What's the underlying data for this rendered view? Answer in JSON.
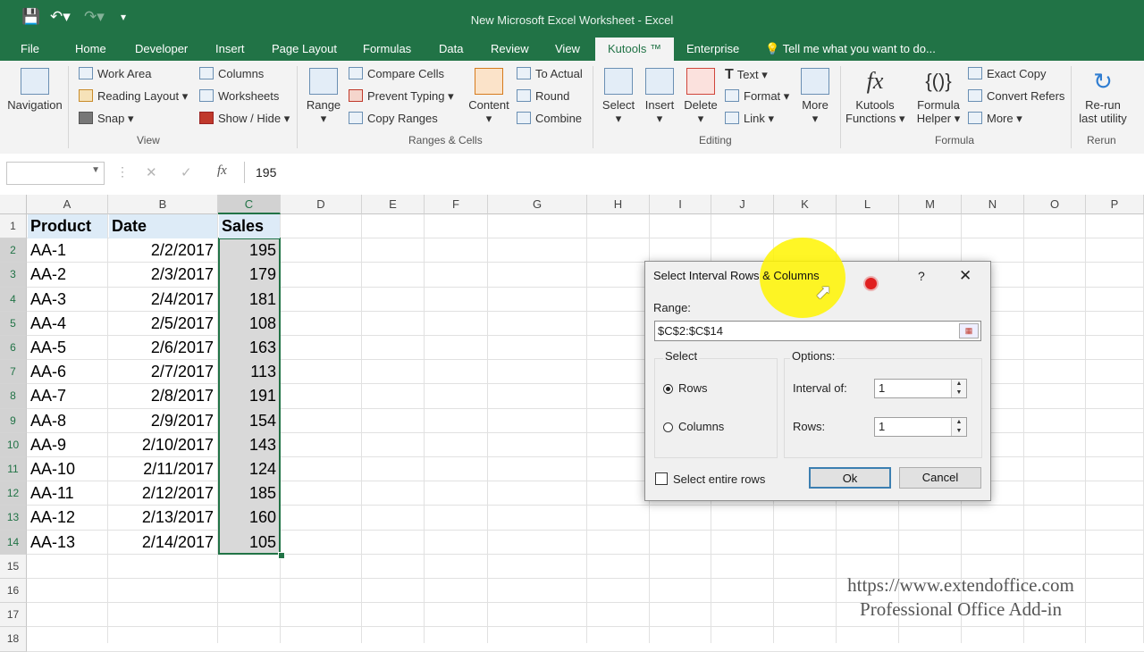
{
  "window": {
    "title": "New Microsoft Excel Worksheet - Excel"
  },
  "qat": {
    "save_icon": "save-icon",
    "undo_icon": "undo-icon",
    "redo_icon": "redo-icon",
    "customize_icon": "customize-qat-icon"
  },
  "menu": {
    "tabs": [
      "File",
      "Home",
      "Developer",
      "Insert",
      "Page Layout",
      "Formulas",
      "Data",
      "Review",
      "View",
      "Kutools ™",
      "Enterprise"
    ],
    "tell_me": "Tell me what you want to do..."
  },
  "ribbon": {
    "navigation": "Navigation",
    "view": {
      "work_area": "Work Area",
      "reading_layout": "Reading Layout",
      "snap": "Snap",
      "columns": "Columns",
      "worksheets": "Worksheets",
      "show_hide": "Show / Hide",
      "group_label": "View"
    },
    "ranges": {
      "range": "Range",
      "compare_cells": "Compare Cells",
      "prevent_typing": "Prevent Typing",
      "copy_ranges": "Copy Ranges",
      "content": "Content",
      "to_actual": "To Actual",
      "round": "Round",
      "combine": "Combine",
      "group_label": "Ranges & Cells"
    },
    "editing": {
      "select": "Select",
      "insert": "Insert",
      "delete": "Delete",
      "text": "Text",
      "format": "Format",
      "link": "Link",
      "more": "More",
      "group_label": "Editing"
    },
    "formula": {
      "kutools_functions_1": "Kutools",
      "kutools_functions_2": "Functions",
      "formula_helper_1": "Formula",
      "formula_helper_2": "Helper",
      "exact_copy": "Exact Copy",
      "convert_refers": "Convert Refers",
      "more": "More",
      "group_label": "Formula"
    },
    "rerun": {
      "label_1": "Re-run",
      "label_2": "last utility",
      "group_label": "Rerun"
    }
  },
  "formula_bar": {
    "name_box": "",
    "fx": "fx",
    "value": "195"
  },
  "sheet": {
    "columns": [
      "A",
      "B",
      "C",
      "D",
      "E",
      "F",
      "G",
      "H",
      "I",
      "J",
      "K",
      "L",
      "M",
      "N",
      "O",
      "P"
    ],
    "rows": [
      "1",
      "2",
      "3",
      "4",
      "5",
      "6",
      "7",
      "8",
      "9",
      "10",
      "11",
      "12",
      "13",
      "14",
      "15",
      "16",
      "17",
      "18"
    ],
    "headers": [
      "Product",
      "Date",
      "Sales"
    ],
    "data": [
      [
        "AA-1",
        "2/2/2017",
        "195"
      ],
      [
        "AA-2",
        "2/3/2017",
        "179"
      ],
      [
        "AA-3",
        "2/4/2017",
        "181"
      ],
      [
        "AA-4",
        "2/5/2017",
        "108"
      ],
      [
        "AA-5",
        "2/6/2017",
        "163"
      ],
      [
        "AA-6",
        "2/7/2017",
        "113"
      ],
      [
        "AA-7",
        "2/8/2017",
        "191"
      ],
      [
        "AA-8",
        "2/9/2017",
        "154"
      ],
      [
        "AA-9",
        "2/10/2017",
        "143"
      ],
      [
        "AA-10",
        "2/11/2017",
        "124"
      ],
      [
        "AA-11",
        "2/12/2017",
        "185"
      ],
      [
        "AA-12",
        "2/13/2017",
        "160"
      ],
      [
        "AA-13",
        "2/14/2017",
        "105"
      ]
    ]
  },
  "dialog": {
    "title": "Select Interval Rows & Columns",
    "help": "?",
    "range_label": "Range:",
    "range_value": "$C$2:$C$14",
    "select_label": "Select",
    "rows_option": "Rows",
    "columns_option": "Columns",
    "selected_option": "Rows",
    "options_label": "Options:",
    "interval_label": "Interval of:",
    "interval_value": "1",
    "rows_label": "Rows:",
    "rows_value": "1",
    "select_entire_rows": "Select entire rows",
    "select_entire_rows_checked": false,
    "ok": "Ok",
    "cancel": "Cancel"
  },
  "watermark": {
    "url": "https://www.extendoffice.com",
    "tagline": "Professional Office Add-in"
  },
  "colors": {
    "excel_green": "#217346",
    "header_fill": "#ddebf7",
    "selection_fill": "#d9d9d9",
    "cursor_highlight": "#fff500",
    "record_dot": "#e02020"
  }
}
